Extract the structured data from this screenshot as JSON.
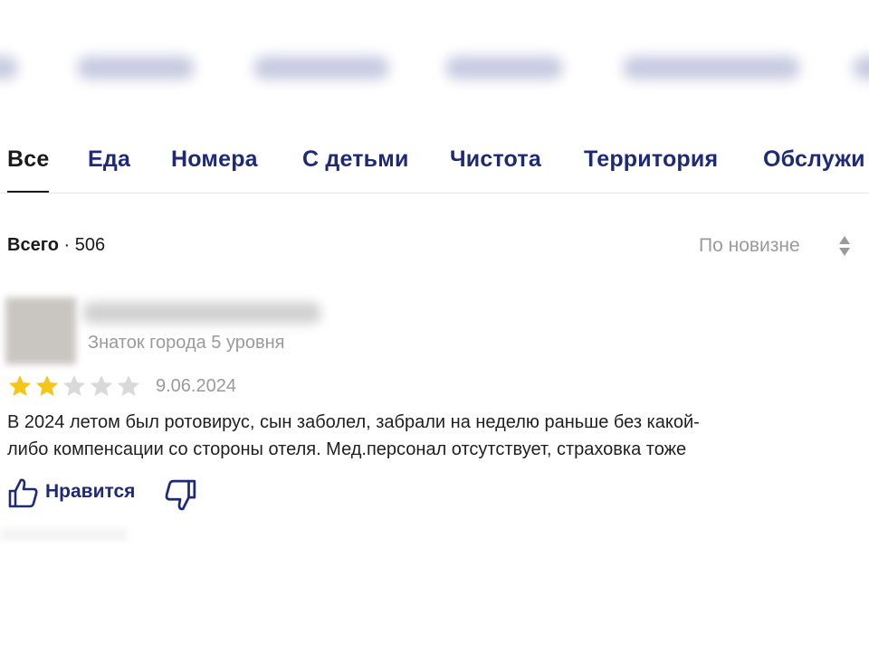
{
  "tabs": [
    {
      "label": "Все",
      "active": true
    },
    {
      "label": "Еда",
      "active": false
    },
    {
      "label": "Номера",
      "active": false
    },
    {
      "label": "С детьми",
      "active": false
    },
    {
      "label": "Чистота",
      "active": false
    },
    {
      "label": "Территория",
      "active": false
    },
    {
      "label": "Обслужи",
      "active": false
    }
  ],
  "summary": {
    "total_label": "Всего",
    "separator": " · ",
    "total_count": "506",
    "sort_label": "По новизне",
    "sort_icon": "sort-arrows-icon"
  },
  "review": {
    "author_level": "Знаток города 5 уровня",
    "rating": 2,
    "rating_max": 5,
    "date": "9.06.2024",
    "text_lines": [
      "В 2024 летом был ротовирус, сын заболел, забрали на неделю раньше без какой-",
      "либо компенсации со стороны отеля. Мед.персонал отсутствует, страховка тоже"
    ],
    "like_label": "Нравится",
    "like_icon": "thumbs-up-icon",
    "dislike_icon": "thumbs-down-icon"
  },
  "colors": {
    "tab_link": "#1e2a78",
    "star_filled": "#f5c518",
    "star_empty": "#d9d9d9",
    "muted_text": "#9a9a9a"
  }
}
